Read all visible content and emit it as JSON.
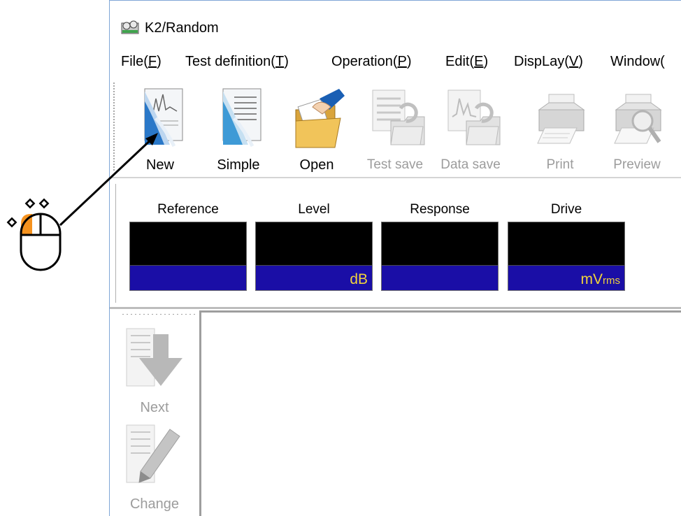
{
  "window": {
    "title": "K2/Random"
  },
  "menu": [
    {
      "label": "File(",
      "key": "F",
      "suffix": ")"
    },
    {
      "label": "Test definition(",
      "key": "T",
      "suffix": ")"
    },
    {
      "label": "Operation(",
      "key": "P",
      "suffix": ")"
    },
    {
      "label": "Edit(",
      "key": "E",
      "suffix": ")"
    },
    {
      "label": "DispLay(",
      "key": "V",
      "suffix": ")"
    },
    {
      "label": "Window(",
      "key": "",
      "suffix": ""
    }
  ],
  "toolbar": {
    "new": "New",
    "simple": "Simple",
    "open": "Open",
    "test_save": "Test save",
    "data_save": "Data save",
    "print": "Print",
    "preview": "Preview"
  },
  "meters": [
    {
      "title": "Reference",
      "unit": "",
      "unit_sub": ""
    },
    {
      "title": "Level",
      "unit": "dB",
      "unit_sub": ""
    },
    {
      "title": "Response",
      "unit": "",
      "unit_sub": ""
    },
    {
      "title": "Drive",
      "unit": "mV",
      "unit_sub": "rms"
    }
  ],
  "side": {
    "next": "Next",
    "change": "Change"
  },
  "colors": {
    "meter_bar": "#1a0ea6",
    "meter_unit": "#f0d23c",
    "mouse_highlight": "#f5921e"
  },
  "icons": {
    "app": "k2-app-icon",
    "new": "new-document-icon",
    "simple": "simple-document-icon",
    "open": "open-folder-icon",
    "test_save": "test-save-icon",
    "data_save": "data-save-icon",
    "print": "printer-icon",
    "preview": "print-preview-icon",
    "next": "next-arrow-icon",
    "change": "change-pencil-icon",
    "annotation": "mouse-left-click-icon"
  }
}
